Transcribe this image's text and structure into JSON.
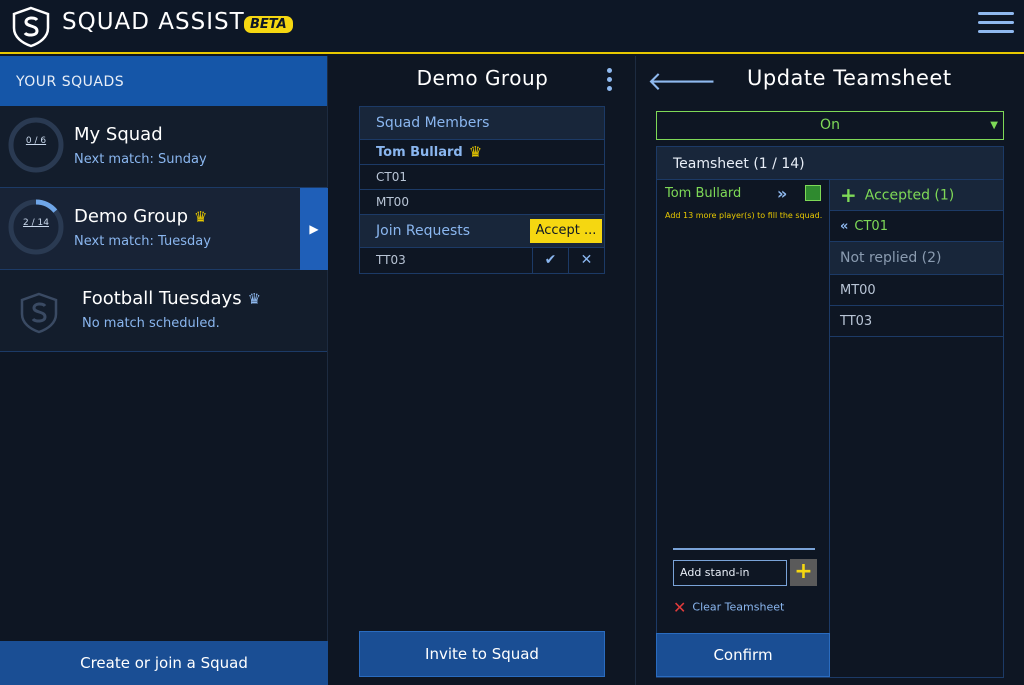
{
  "app": {
    "title": "SQUAD ASSIST",
    "badge": "BETA"
  },
  "sidebar": {
    "header": "YOUR SQUADS",
    "squads": [
      {
        "name": "My Squad",
        "next": "Next match: Sunday",
        "count": "0 / 6",
        "progress": 0,
        "owner": false
      },
      {
        "name": "Demo Group",
        "next": "Next match: Tuesday",
        "count": "2 / 14",
        "progress": 0.14,
        "owner": true,
        "active": true
      },
      {
        "name": "Football Tuesdays",
        "next": "No match scheduled.",
        "owner": true
      }
    ],
    "create_label": "Create or join a Squad"
  },
  "group": {
    "title": "Demo Group",
    "members_header": "Squad Members",
    "members": [
      "Tom Bullard",
      "CT01",
      "MT00"
    ],
    "requests_header": "Join Requests",
    "accept_all_label": "Accept ...",
    "requests": [
      "TT03"
    ],
    "invite_label": "Invite to Squad"
  },
  "teamsheet": {
    "title": "Update Teamsheet",
    "status_select": "On",
    "header": "Teamsheet (1 / 14)",
    "selected_player": "Tom Bullard",
    "fill_message": "Add 13 more player(s) to fill the squad.",
    "standin_value": "Add stand-in",
    "clear_label": "Clear Teamsheet",
    "confirm_label": "Confirm",
    "accepted_header": "Accepted (1)",
    "accepted": [
      "CT01"
    ],
    "not_replied_header": "Not replied (2)",
    "not_replied": [
      "MT00",
      "TT03"
    ]
  },
  "colors": {
    "accent": "#1556a8",
    "highlight": "#f5d711",
    "success": "#7ed957"
  }
}
